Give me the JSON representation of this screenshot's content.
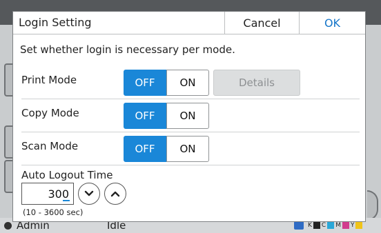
{
  "background": {
    "user": "Admin",
    "status": "Idle",
    "ink_labels": [
      "K",
      "C",
      "M",
      "Y"
    ],
    "ink_colors": [
      "#222222",
      "#2aa7d8",
      "#d23c8e",
      "#f0c419"
    ]
  },
  "dialog": {
    "title": "Login Setting",
    "cancel_label": "Cancel",
    "ok_label": "OK",
    "description": "Set whether login is necessary per mode."
  },
  "modes": [
    {
      "label": "Print Mode",
      "off_label": "OFF",
      "on_label": "ON",
      "selected": "OFF"
    },
    {
      "label": "Copy Mode",
      "off_label": "OFF",
      "on_label": "ON",
      "selected": "OFF"
    },
    {
      "label": "Scan Mode",
      "off_label": "OFF",
      "on_label": "ON",
      "selected": "OFF"
    }
  ],
  "details_label": "Details",
  "auto_logout": {
    "label": "Auto Logout Time",
    "value": "300",
    "range": "(10 - 3600 sec)"
  },
  "colors": {
    "accent": "#1a87d8",
    "ok_text": "#1676c9"
  }
}
